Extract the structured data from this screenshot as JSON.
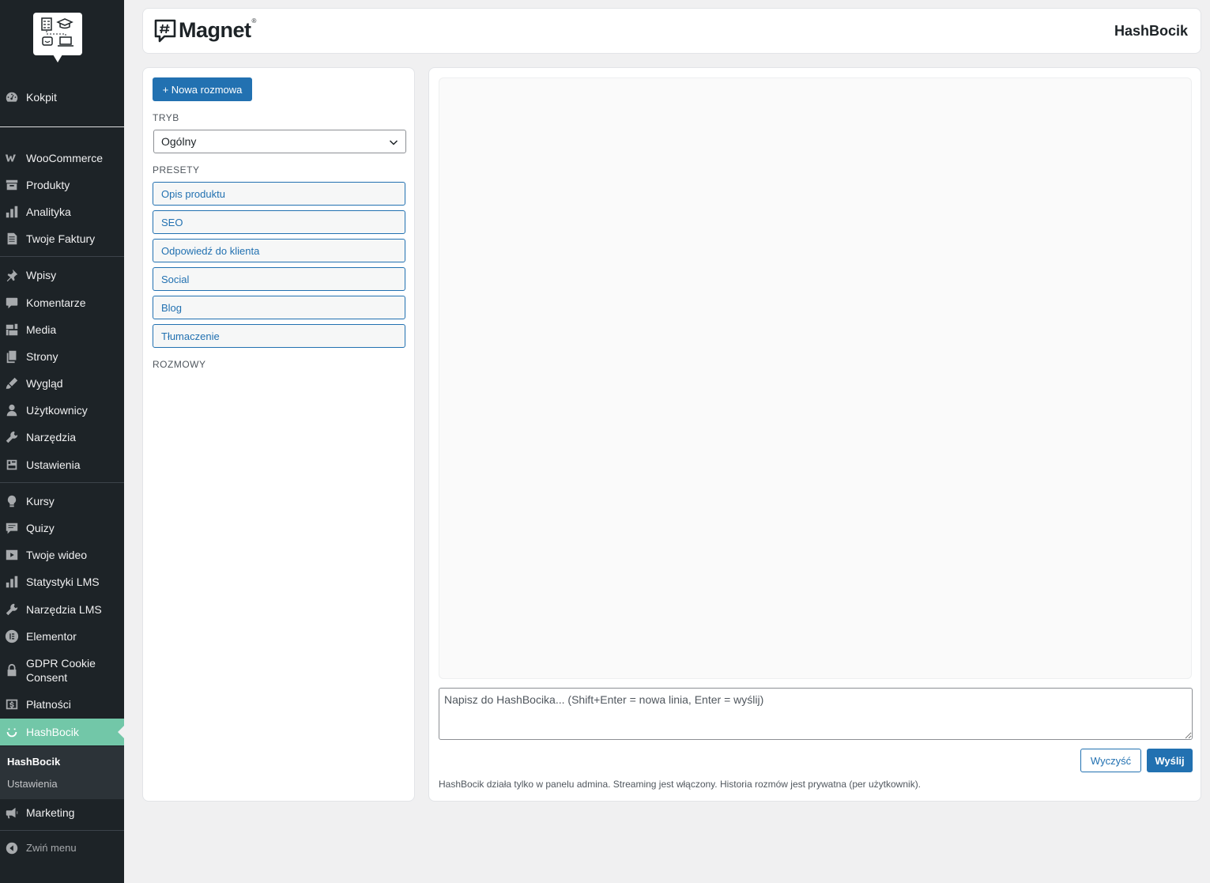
{
  "sidebar": {
    "items": [
      {
        "label": "Kokpit",
        "icon": "dashboard-icon"
      },
      {
        "label": "WooCommerce",
        "icon": "woocommerce-icon"
      },
      {
        "label": "Produkty",
        "icon": "archive-icon"
      },
      {
        "label": "Analityka",
        "icon": "bar-chart-icon"
      },
      {
        "label": "Twoje Faktury",
        "icon": "document-icon"
      },
      {
        "label": "Wpisy",
        "icon": "pin-icon"
      },
      {
        "label": "Komentarze",
        "icon": "comment-icon"
      },
      {
        "label": "Media",
        "icon": "media-icon"
      },
      {
        "label": "Strony",
        "icon": "pages-icon"
      },
      {
        "label": "Wygląd",
        "icon": "brush-icon"
      },
      {
        "label": "Użytkownicy",
        "icon": "user-icon"
      },
      {
        "label": "Narzędzia",
        "icon": "wrench-icon"
      },
      {
        "label": "Ustawienia",
        "icon": "settings-icon"
      },
      {
        "label": "Kursy",
        "icon": "lightbulb-icon"
      },
      {
        "label": "Quizy",
        "icon": "quiz-icon"
      },
      {
        "label": "Twoje wideo",
        "icon": "video-icon"
      },
      {
        "label": "Statystyki LMS",
        "icon": "bar-chart-icon"
      },
      {
        "label": "Narzędzia LMS",
        "icon": "wrench-icon"
      },
      {
        "label": "Elementor",
        "icon": "elementor-icon"
      },
      {
        "label": "GDPR Cookie Consent",
        "icon": "lock-icon"
      },
      {
        "label": "Płatności",
        "icon": "dollar-icon"
      },
      {
        "label": "HashBocik",
        "icon": "smile-icon"
      },
      {
        "label": "Marketing",
        "icon": "megaphone-icon"
      }
    ],
    "submenu": {
      "active": "HashBocik",
      "other": "Ustawienia"
    },
    "collapse_label": "Zwiń menu"
  },
  "header": {
    "brand": "Magnet",
    "brand_mark": "®",
    "title": "HashBocik"
  },
  "left_panel": {
    "new_button": "+ Nowa rozmowa",
    "mode_label": "TRYB",
    "mode_value": "Ogólny",
    "presets_label": "PRESETY",
    "presets": [
      "Opis produktu",
      "SEO",
      "Odpowiedź do klienta",
      "Social",
      "Blog",
      "Tłumaczenie"
    ],
    "conversations_label": "ROZMOWY"
  },
  "chat": {
    "input_placeholder": "Napisz do HashBocika... (Shift+Enter = nowa linia, Enter = wyślij)",
    "clear_button": "Wyczyść",
    "send_button": "Wyślij",
    "footnote": "HashBocik działa tylko w panelu admina. Streaming jest włączony. Historia rozmów jest prywatna (per użytkownik)."
  },
  "colors": {
    "sidebar_bg": "#1d2327",
    "active_item": "#72c7a8",
    "primary": "#2271b1"
  }
}
